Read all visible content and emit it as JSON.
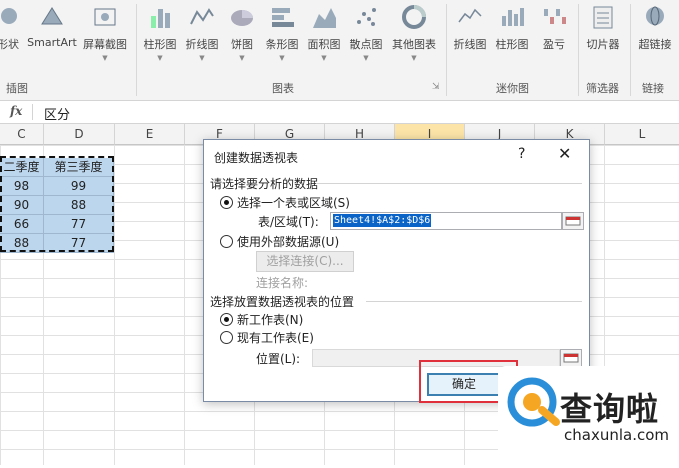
{
  "ribbon": {
    "buttons": [
      {
        "label": "形状",
        "icon": "shapes-icon"
      },
      {
        "label": "SmartArt",
        "icon": "smartart-icon"
      },
      {
        "label": "屏幕截图",
        "icon": "screenshot-icon"
      },
      {
        "label": "柱形图",
        "icon": "column-chart-icon"
      },
      {
        "label": "折线图",
        "icon": "line-chart-icon"
      },
      {
        "label": "饼图",
        "icon": "pie-chart-icon"
      },
      {
        "label": "条形图",
        "icon": "bar-chart-icon"
      },
      {
        "label": "面积图",
        "icon": "area-chart-icon"
      },
      {
        "label": "散点图",
        "icon": "scatter-chart-icon"
      },
      {
        "label": "其他图表",
        "icon": "other-charts-icon"
      },
      {
        "label": "折线图",
        "icon": "sparkline-line-icon"
      },
      {
        "label": "柱形图",
        "icon": "sparkline-column-icon"
      },
      {
        "label": "盈亏",
        "icon": "win-loss-icon"
      },
      {
        "label": "切片器",
        "icon": "slicer-icon"
      },
      {
        "label": "超链接",
        "icon": "hyperlink-icon"
      }
    ],
    "groups": [
      "插图",
      "图表",
      "迷你图",
      "筛选器",
      "链接"
    ]
  },
  "formula_bar": {
    "fx": "fx",
    "value": "区分"
  },
  "columns": [
    "C",
    "D",
    "E",
    "F",
    "G",
    "H",
    "I",
    "J",
    "K",
    "L"
  ],
  "sheet": {
    "headers": [
      "二季度",
      "第三季度"
    ],
    "rows": [
      [
        "98",
        "99"
      ],
      [
        "90",
        "88"
      ],
      [
        "66",
        "77"
      ],
      [
        "88",
        "77"
      ]
    ]
  },
  "dialog": {
    "title": "创建数据透视表",
    "help": "?",
    "close": "✕",
    "section1": "请选择要分析的数据",
    "opt_table": "选择一个表或区域(S)",
    "range_label": "表/区域(T):",
    "range_value": "Sheet4!$A$2:$D$6",
    "opt_external": "使用外部数据源(U)",
    "choose_conn": "选择连接(C)...",
    "conn_name_label": "连接名称:",
    "section2": "选择放置数据透视表的位置",
    "opt_new": "新工作表(N)",
    "opt_existing": "现有工作表(E)",
    "location_label": "位置(L):",
    "ok": "确定"
  },
  "watermark": {
    "brand": "查询啦",
    "url": "chaxunla.com"
  },
  "colors": {
    "accent": "#217346",
    "selection": "#bcd6ee",
    "highlight_box": "#e0303c"
  }
}
